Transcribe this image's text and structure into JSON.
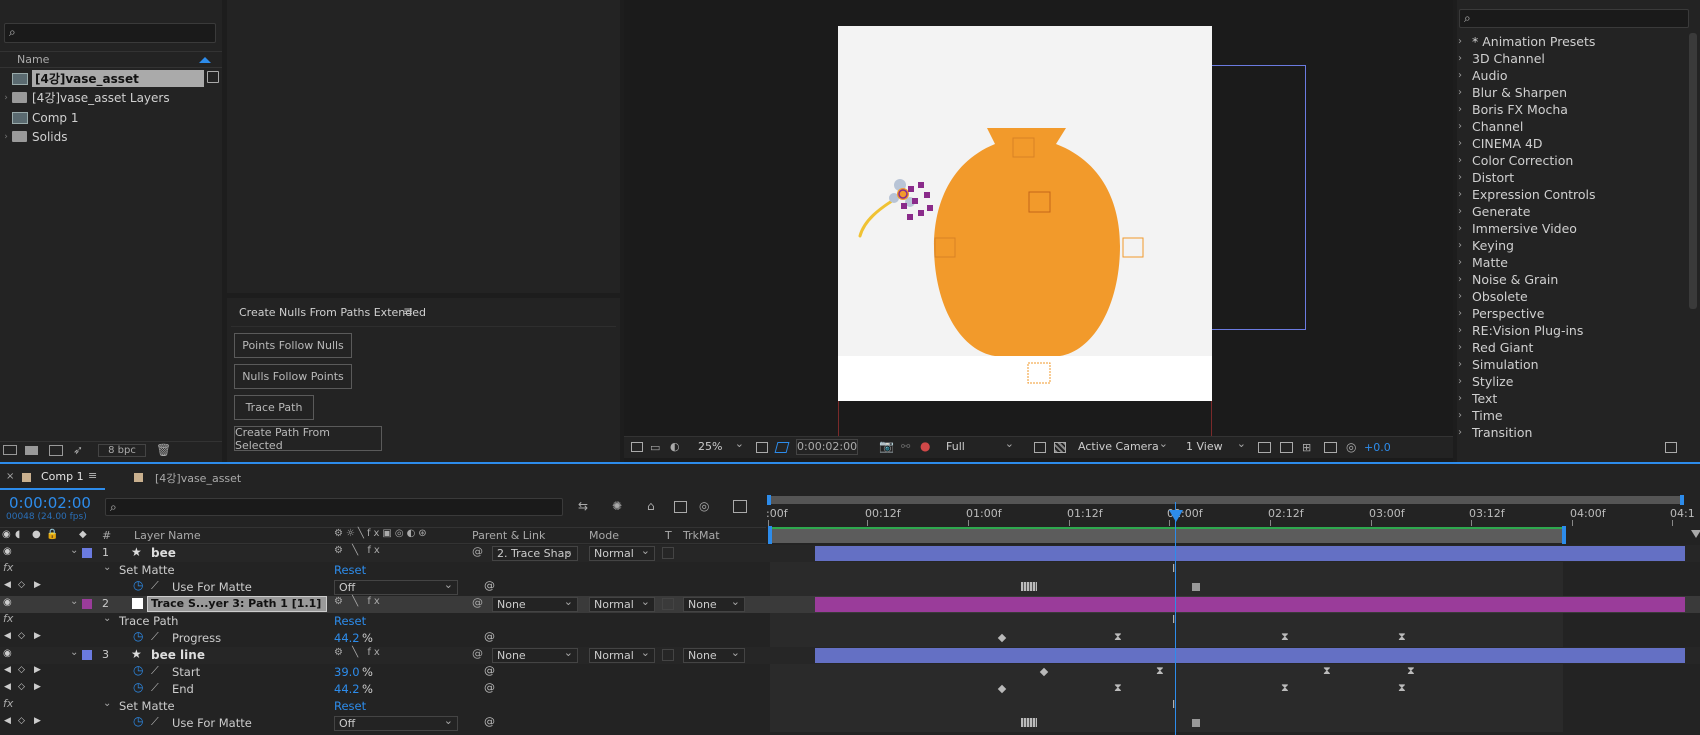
{
  "project": {
    "search_icon": "search-icon",
    "name_header": "Name",
    "items": [
      {
        "label": "[4강]vase_asset",
        "type": "comp",
        "selected": true
      },
      {
        "label": "[4강]vase_asset Layers",
        "type": "folder"
      },
      {
        "label": "Comp 1",
        "type": "comp"
      },
      {
        "label": "Solids",
        "type": "folder"
      }
    ],
    "bpc": "8 bpc"
  },
  "script_panel": {
    "title": "Create Nulls From Paths Extended",
    "buttons": [
      "Points Follow Nulls",
      "Nulls Follow Points",
      "Trace Path",
      "Create Path From Selected"
    ]
  },
  "viewer": {
    "zoom": "25%",
    "timecode": "0:00:02:00",
    "resolution": "Full",
    "camera": "Active Camera",
    "views": "1 View",
    "exposure": "+0.0",
    "colors": {
      "vase": "#f29a2b",
      "bg": "#f3f3f3",
      "dot": "#8a2b8a"
    }
  },
  "effects": {
    "items": [
      "* Animation Presets",
      "3D Channel",
      "Audio",
      "Blur & Sharpen",
      "Boris FX Mocha",
      "Channel",
      "CINEMA 4D",
      "Color Correction",
      "Distort",
      "Expression Controls",
      "Generate",
      "Immersive Video",
      "Keying",
      "Matte",
      "Noise & Grain",
      "Obsolete",
      "Perspective",
      "RE:Vision Plug-ins",
      "Red Giant",
      "Simulation",
      "Stylize",
      "Text",
      "Time",
      "Transition"
    ]
  },
  "timeline": {
    "tabs": [
      {
        "label": "Comp 1",
        "active": true
      },
      {
        "label": "[4강]vase_asset",
        "active": false
      }
    ],
    "timecode": "0:00:02:00",
    "frames": "00048 (24.00 fps)",
    "headers": {
      "num": "#",
      "layer_name": "Layer Name",
      "parent": "Parent & Link",
      "mode": "Mode",
      "t": "T",
      "trkmat": "TrkMat"
    },
    "ruler": [
      ":00f",
      "00:12f",
      "01:00f",
      "01:12f",
      "02:00f",
      "02:12f",
      "03:00f",
      "03:12f",
      "04:00f",
      "04:1"
    ],
    "rows": [
      {
        "kind": "layer",
        "num": "1",
        "name": "bee",
        "parent": "2. Trace Shap",
        "mode": "Normal",
        "trkmat": "",
        "color": "#6b7be0"
      },
      {
        "kind": "group",
        "name": "Set Matte",
        "value": "Reset"
      },
      {
        "kind": "prop",
        "name": "Use For Matte",
        "value": "Off"
      },
      {
        "kind": "layer",
        "num": "2",
        "name": "Trace S...yer 3: Path 1 [1.1]",
        "parent": "None",
        "mode": "Normal",
        "trkmat": "None",
        "color": "#9a3c9a"
      },
      {
        "kind": "group",
        "name": "Trace Path",
        "value": "Reset"
      },
      {
        "kind": "prop",
        "name": "Progress",
        "value": "44.2",
        "unit": "%"
      },
      {
        "kind": "layer",
        "num": "3",
        "name": "bee line",
        "parent": "None",
        "mode": "Normal",
        "trkmat": "None",
        "color": "#6b7be0"
      },
      {
        "kind": "prop",
        "name": "Start",
        "value": "39.0",
        "unit": "%"
      },
      {
        "kind": "prop",
        "name": "End",
        "value": "44.2",
        "unit": "%"
      },
      {
        "kind": "group",
        "name": "Set Matte",
        "value": "Reset"
      },
      {
        "kind": "prop",
        "name": "Use For Matte",
        "value": "Off"
      }
    ]
  }
}
